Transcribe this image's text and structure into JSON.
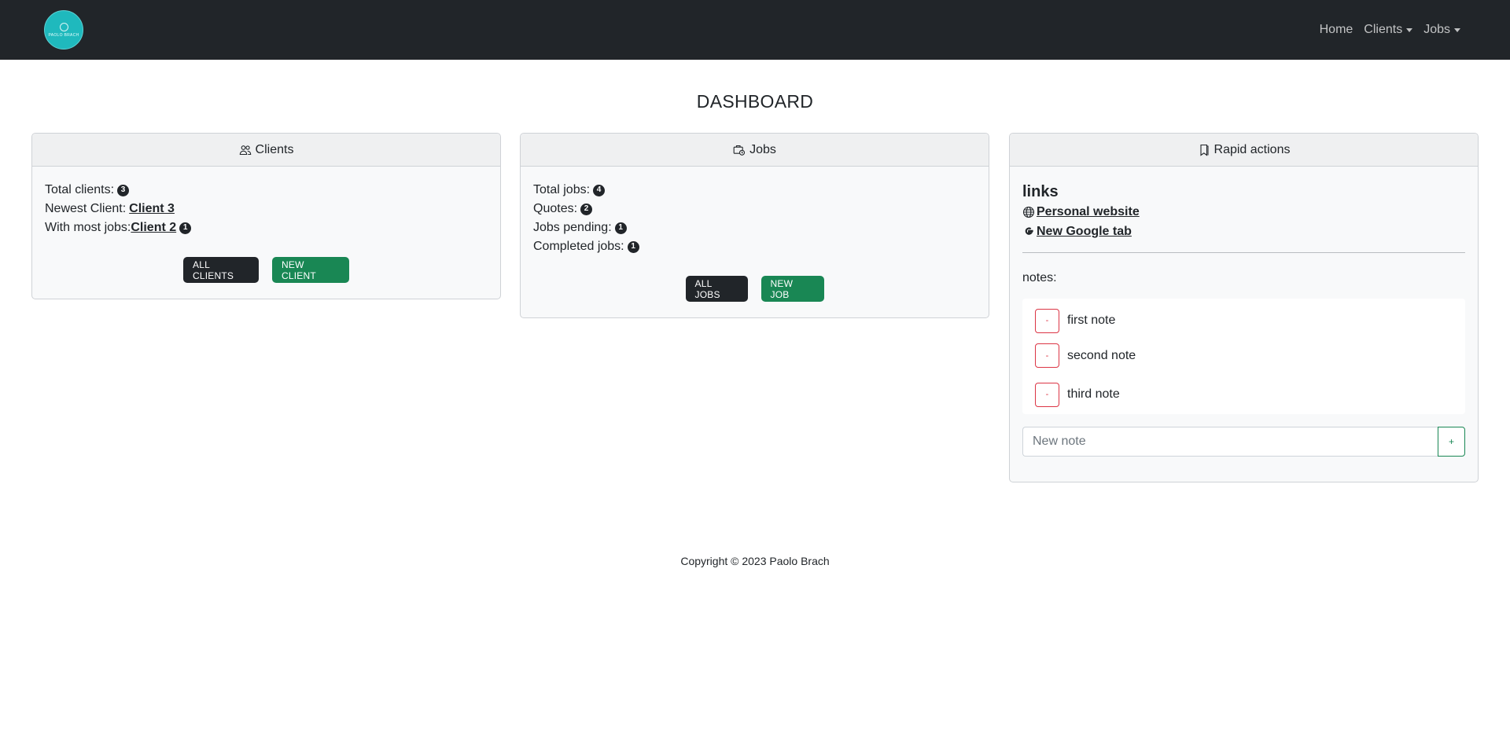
{
  "navbar": {
    "logo_icon": "lotus-icon",
    "logo_text": "PAOLO BRACH",
    "links": {
      "home": "Home",
      "clients": "Clients",
      "jobs": "Jobs"
    }
  },
  "page": {
    "title": "DASHBOARD"
  },
  "clients_card": {
    "header": "Clients",
    "icon": "people-icon",
    "total_label": "Total clients:",
    "total_value": "3",
    "newest_label": "Newest Client:",
    "newest_value": "Client 3",
    "most_jobs_label": "With most jobs:",
    "most_jobs_value": "Client 2",
    "most_jobs_count": "1",
    "btn_all": "ALL CLIENTS",
    "btn_new": "NEW CLIENT"
  },
  "jobs_card": {
    "header": "Jobs",
    "icon": "briefcase-icon",
    "total_label": "Total jobs:",
    "total_value": "4",
    "quotes_label": "Quotes:",
    "quotes_value": "2",
    "pending_label": "Jobs pending:",
    "pending_value": "1",
    "completed_label": "Completed jobs:",
    "completed_value": "1",
    "btn_all": "ALL JOBS",
    "btn_new": "NEW JOB"
  },
  "rapid_card": {
    "header": "Rapid actions",
    "icon": "bookmark-icon",
    "links_title": "links",
    "link_website": "Personal website",
    "link_google": "New Google tab",
    "notes_label": "notes:",
    "notes": [
      {
        "delete_label": "-",
        "text": "first note"
      },
      {
        "delete_label": "-",
        "text": "second note"
      },
      {
        "delete_label": "-",
        "text": "third note"
      }
    ],
    "new_note_placeholder": "New note",
    "add_label": "+"
  },
  "footer": {
    "text": "Copyright © 2023 Paolo Brach"
  },
  "colors": {
    "navbar": "#212529",
    "card_bg": "#f8f9fa",
    "dark_button": "#212529",
    "green_button": "#198754",
    "danger": "#dc3545",
    "logo": "#1fb9bd"
  }
}
